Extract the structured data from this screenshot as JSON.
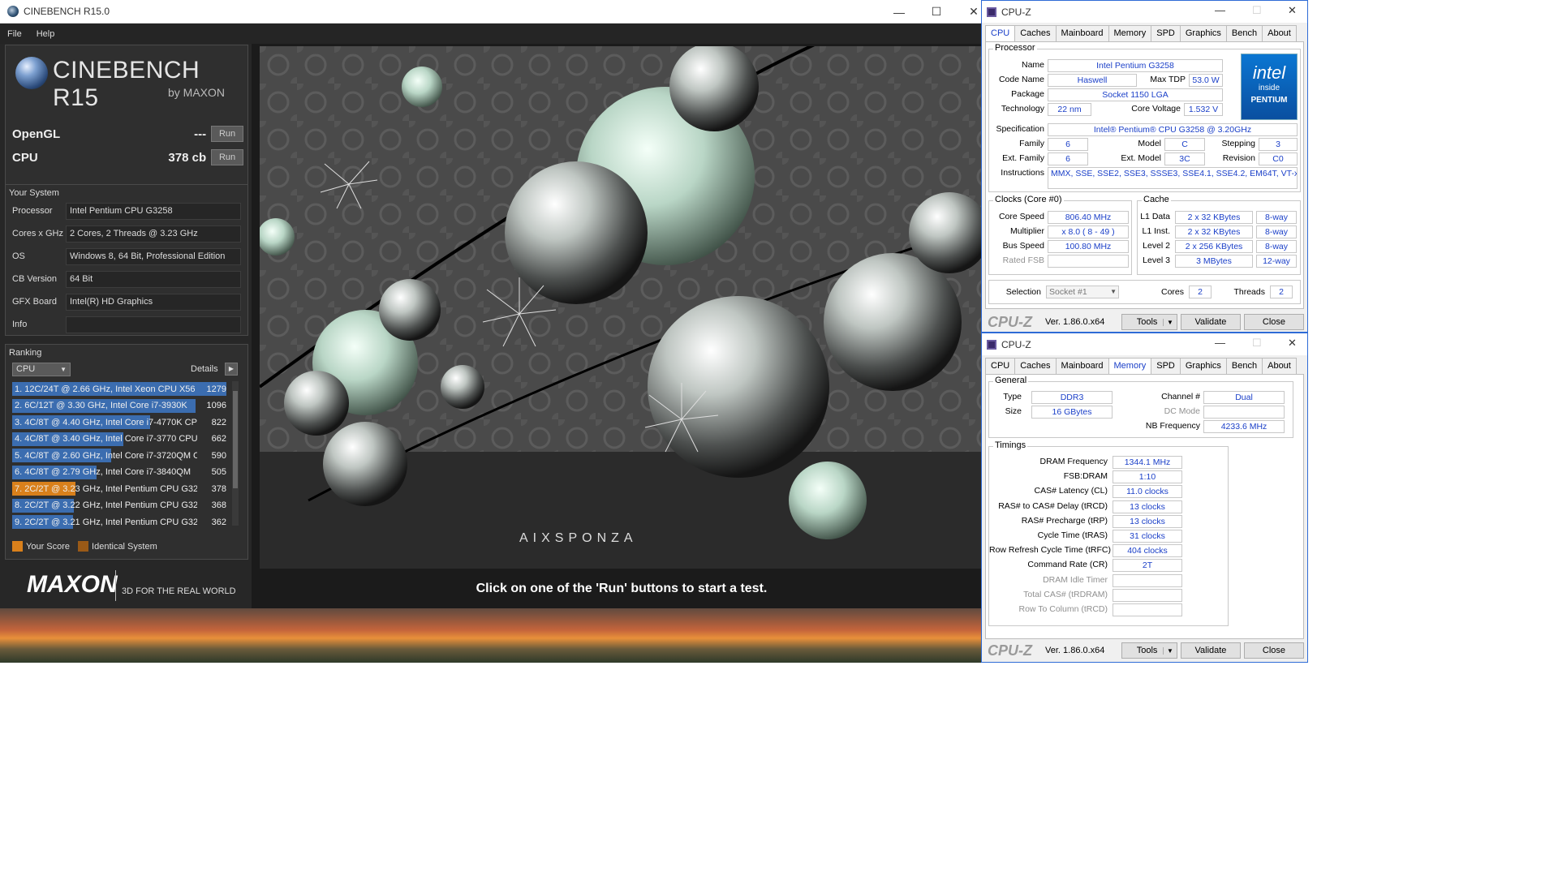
{
  "cinebench": {
    "window_title": "CINEBENCH R15.0",
    "menu": [
      "File",
      "Help"
    ],
    "logo_title": "CINEBENCH R15",
    "logo_sub": "by MAXON",
    "opengl": {
      "label": "OpenGL",
      "value": "---",
      "button": "Run"
    },
    "cpu": {
      "label": "CPU",
      "value": "378 cb",
      "button": "Run"
    },
    "your_system": {
      "heading": "Your System",
      "rows": [
        {
          "key": "Processor",
          "value": "Intel Pentium CPU G3258"
        },
        {
          "key": "Cores x GHz",
          "value": "2 Cores, 2 Threads @ 3.23 GHz"
        },
        {
          "key": "OS",
          "value": "Windows 8, 64 Bit, Professional Edition"
        },
        {
          "key": "CB Version",
          "value": "64 Bit"
        },
        {
          "key": "GFX Board",
          "value": "Intel(R) HD Graphics"
        },
        {
          "key": "Info",
          "value": ""
        }
      ]
    },
    "ranking": {
      "heading": "Ranking",
      "selector": "CPU",
      "details": "Details",
      "rows": [
        {
          "text": "1. 12C/24T @ 2.66 GHz, Intel Xeon CPU X56",
          "score": "1279",
          "fill": 1.0,
          "highlight": false
        },
        {
          "text": "2. 6C/12T @ 3.30 GHz,  Intel Core i7-3930K",
          "score": "1096",
          "fill": 0.857,
          "highlight": false
        },
        {
          "text": "3. 4C/8T @ 4.40 GHz, Intel Core i7-4770K CP",
          "score": "822",
          "fill": 0.643,
          "highlight": false
        },
        {
          "text": "4. 4C/8T @ 3.40 GHz,  Intel Core i7-3770 CPU",
          "score": "662",
          "fill": 0.518,
          "highlight": false
        },
        {
          "text": "5. 4C/8T @ 2.60 GHz, Intel Core i7-3720QM C",
          "score": "590",
          "fill": 0.461,
          "highlight": false
        },
        {
          "text": "6. 4C/8T @ 2.79 GHz,  Intel Core i7-3840QM",
          "score": "505",
          "fill": 0.395,
          "highlight": false
        },
        {
          "text": "7. 2C/2T @ 3.23 GHz, Intel Pentium CPU G32",
          "score": "378",
          "fill": 0.296,
          "highlight": true
        },
        {
          "text": "8. 2C/2T @ 3.22 GHz, Intel Pentium CPU G32",
          "score": "368",
          "fill": 0.288,
          "highlight": false
        },
        {
          "text": "9. 2C/2T @ 3.21 GHz, Intel Pentium CPU G32",
          "score": "362",
          "fill": 0.283,
          "highlight": false
        }
      ],
      "legend_your": "Your Score",
      "legend_identical": "Identical System"
    },
    "maxon": "MAXON",
    "maxon_tag": "3D FOR THE REAL WORLD",
    "render_brand": "AIXSPONZA",
    "message": "Click on one of the 'Run' buttons to start a test.",
    "colors": {
      "bar": "#3b6db0",
      "your_score": "#d9801b",
      "identical": "#9a5a17"
    }
  },
  "cpuz_common": {
    "title": "CPU-Z",
    "tabs": [
      "CPU",
      "Caches",
      "Mainboard",
      "Memory",
      "SPD",
      "Graphics",
      "Bench",
      "About"
    ],
    "logo": "CPU-Z",
    "version": "Ver. 1.86.0.x64",
    "tools": "Tools",
    "validate": "Validate",
    "close": "Close"
  },
  "cpuz_cpu": {
    "processor_label": "Processor",
    "name": "Intel Pentium G3258",
    "code_name": "Haswell",
    "max_tdp": "53.0 W",
    "package": "Socket 1150 LGA",
    "technology": "22 nm",
    "core_voltage": "1.532 V",
    "specification": "Intel® Pentium® CPU G3258 @ 3.20GHz",
    "family": "6",
    "model": "C",
    "stepping": "3",
    "ext_family": "6",
    "ext_model": "3C",
    "revision": "C0",
    "instructions": "MMX, SSE, SSE2, SSE3, SSSE3, SSE4.1, SSE4.2, EM64T, VT-x",
    "labels": {
      "name": "Name",
      "code_name": "Code Name",
      "max_tdp": "Max TDP",
      "package": "Package",
      "technology": "Technology",
      "core_voltage": "Core Voltage",
      "specification": "Specification",
      "family": "Family",
      "model": "Model",
      "stepping": "Stepping",
      "ext_family": "Ext. Family",
      "ext_model": "Ext. Model",
      "revision": "Revision",
      "instructions": "Instructions"
    },
    "clocks": {
      "heading": "Clocks (Core #0)",
      "core_speed_label": "Core Speed",
      "core_speed": "806.40 MHz",
      "multiplier_label": "Multiplier",
      "multiplier": "x 8.0 ( 8 - 49 )",
      "bus_speed_label": "Bus Speed",
      "bus_speed": "100.80 MHz",
      "rated_fsb_label": "Rated FSB",
      "rated_fsb": ""
    },
    "cache": {
      "heading": "Cache",
      "rows": [
        {
          "label": "L1 Data",
          "size": "2 x 32 KBytes",
          "way": "8-way"
        },
        {
          "label": "L1 Inst.",
          "size": "2 x 32 KBytes",
          "way": "8-way"
        },
        {
          "label": "Level 2",
          "size": "2 x 256 KBytes",
          "way": "8-way"
        },
        {
          "label": "Level 3",
          "size": "3 MBytes",
          "way": "12-way"
        }
      ]
    },
    "selection_label": "Selection",
    "selection": "Socket #1",
    "cores_label": "Cores",
    "cores": "2",
    "threads_label": "Threads",
    "threads": "2",
    "intel_logo": {
      "brand": "intel",
      "inside": "inside",
      "product": "PENTIUM"
    }
  },
  "cpuz_memory": {
    "general": {
      "heading": "General",
      "type_label": "Type",
      "type": "DDR3",
      "size_label": "Size",
      "size": "16 GBytes",
      "channel_label": "Channel #",
      "channel": "Dual",
      "dc_mode_label": "DC Mode",
      "dc_mode": "",
      "nb_freq_label": "NB Frequency",
      "nb_freq": "4233.6 MHz"
    },
    "timings": {
      "heading": "Timings",
      "rows": [
        {
          "label": "DRAM Frequency",
          "value": "1344.1 MHz",
          "dim": false
        },
        {
          "label": "FSB:DRAM",
          "value": "1:10",
          "dim": false
        },
        {
          "label": "CAS# Latency (CL)",
          "value": "11.0 clocks",
          "dim": false
        },
        {
          "label": "RAS# to CAS# Delay (tRCD)",
          "value": "13 clocks",
          "dim": false
        },
        {
          "label": "RAS# Precharge (tRP)",
          "value": "13 clocks",
          "dim": false
        },
        {
          "label": "Cycle Time (tRAS)",
          "value": "31 clocks",
          "dim": false
        },
        {
          "label": "Row Refresh Cycle Time (tRFC)",
          "value": "404 clocks",
          "dim": false
        },
        {
          "label": "Command Rate (CR)",
          "value": "2T",
          "dim": false
        },
        {
          "label": "DRAM Idle Timer",
          "value": "",
          "dim": true
        },
        {
          "label": "Total CAS# (tRDRAM)",
          "value": "",
          "dim": true
        },
        {
          "label": "Row To Column (tRCD)",
          "value": "",
          "dim": true
        }
      ]
    }
  }
}
